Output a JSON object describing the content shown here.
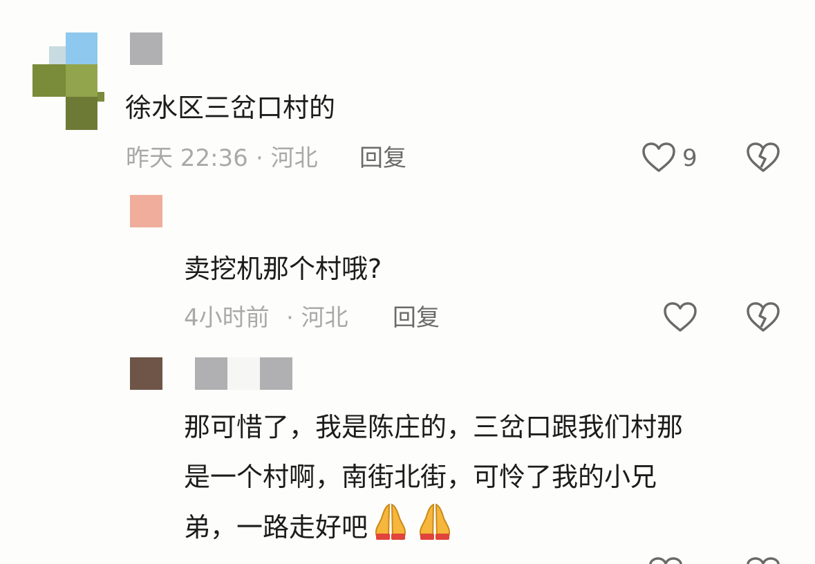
{
  "comments": [
    {
      "text": "徐水区三岔口村的",
      "time": "昨天 22:36",
      "location": "· 河北",
      "reply_label": "回复",
      "like_count": "9"
    },
    {
      "text": "卖挖机那个村哦?",
      "time": "4小时前",
      "location": "· 河北",
      "reply_label": "回复",
      "like_count": ""
    },
    {
      "text_lines": [
        "那可惜了，我是陈庄的，三岔口跟我们村那",
        "是一个村啊，南街北街，可怜了我的小兄",
        "弟，一路走好吧"
      ],
      "emojis": [
        "folded-hands",
        "folded-hands"
      ]
    }
  ],
  "icons": {
    "like": "heart-outline-icon",
    "dislike": "broken-heart-icon"
  },
  "colors": {
    "background": "#fdfdfb",
    "text": "#1c1c1c",
    "meta": "#a9a9a9",
    "reply": "#6a6a6a",
    "icon": "#6a6a6a"
  }
}
